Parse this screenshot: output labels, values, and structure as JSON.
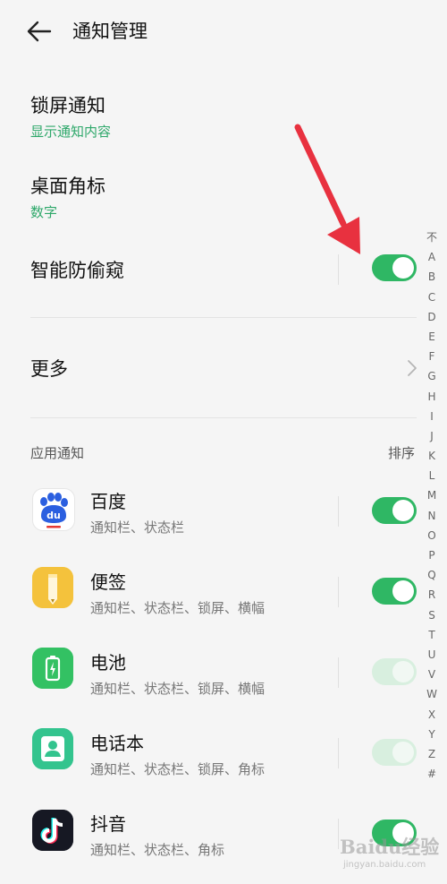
{
  "header": {
    "title": "通知管理",
    "back_icon": "arrow-left-icon"
  },
  "settings": {
    "lock_screen": {
      "label": "锁屏通知",
      "value": "显示通知内容"
    },
    "badge": {
      "label": "桌面角标",
      "value": "数字"
    },
    "anti_peek": {
      "label": "智能防偷窥",
      "enabled": true
    },
    "more": {
      "label": "更多",
      "icon": "chevron-right-icon"
    }
  },
  "app_section": {
    "label": "应用通知",
    "sort_label": "排序",
    "apps": [
      {
        "name": "百度",
        "detail": "通知栏、状态栏",
        "icon": "baidu-paw-icon",
        "enabled": true,
        "disabled": false
      },
      {
        "name": "便签",
        "detail": "通知栏、状态栏、锁屏、横幅",
        "icon": "notes-pen-icon",
        "enabled": true,
        "disabled": false
      },
      {
        "name": "电池",
        "detail": "通知栏、状态栏、锁屏、横幅",
        "icon": "battery-icon",
        "enabled": true,
        "disabled": true
      },
      {
        "name": "电话本",
        "detail": "通知栏、状态栏、锁屏、角标",
        "icon": "contacts-icon",
        "enabled": true,
        "disabled": true
      },
      {
        "name": "抖音",
        "detail": "通知栏、状态栏、角标",
        "icon": "douyin-icon",
        "enabled": true,
        "disabled": false
      }
    ]
  },
  "alpha_index": [
    "不",
    "A",
    "B",
    "C",
    "D",
    "E",
    "F",
    "G",
    "H",
    "I",
    "J",
    "K",
    "L",
    "M",
    "N",
    "O",
    "P",
    "Q",
    "R",
    "S",
    "T",
    "U",
    "V",
    "W",
    "X",
    "Y",
    "Z",
    "#"
  ],
  "annotation": {
    "arrow_color": "#e8313f"
  },
  "watermark": {
    "text": "Baidu经验",
    "sub": "jingyan.baidu.com"
  },
  "colors": {
    "accent": "#2fb764",
    "accent_disabled": "#d8efdf",
    "subtitle_green": "#2ea86a"
  }
}
